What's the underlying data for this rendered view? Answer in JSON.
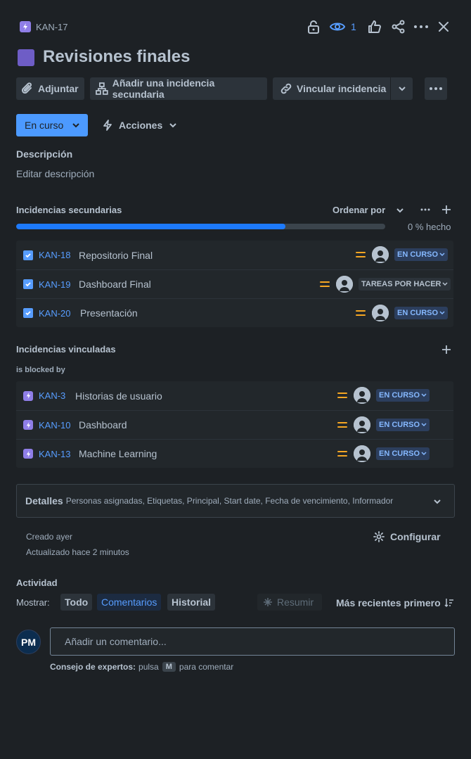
{
  "header": {
    "issue_key": "KAN-17",
    "watch_count": "1",
    "title": "Revisiones finales"
  },
  "toolbar": {
    "attach_label": "Adjuntar",
    "add_child_label": "Añadir una incidencia secundaria",
    "link_label": "Vincular incidencia"
  },
  "status": {
    "current": "En curso",
    "actions_label": "Acciones"
  },
  "description": {
    "heading": "Descripción",
    "placeholder": "Editar descripción"
  },
  "child_issues": {
    "heading": "Incidencias secundarias",
    "order_label": "Ordenar por",
    "progress_label": "0 % hecho",
    "progress_fraction": 0.73,
    "items": [
      {
        "key": "KAN-18",
        "summary": "Repositorio Final",
        "status": "EN CURSO"
      },
      {
        "key": "KAN-19",
        "summary": "Dashboard Final",
        "status": "TAREAS POR HACER"
      },
      {
        "key": "KAN-20",
        "summary": "Presentación",
        "status": "EN CURSO"
      }
    ]
  },
  "linked_issues": {
    "heading": "Incidencias vinculadas",
    "relation": "is blocked by",
    "items": [
      {
        "key": "KAN-3",
        "summary": "Historias de usuario",
        "status": "EN CURSO"
      },
      {
        "key": "KAN-10",
        "summary": "Dashboard",
        "status": "EN CURSO"
      },
      {
        "key": "KAN-13",
        "summary": "Machine Learning",
        "status": "EN CURSO"
      }
    ]
  },
  "details": {
    "heading": "Detalles",
    "fields_summary": "Personas asignadas, Etiquetas, Principal, Start date, Fecha de vencimiento, Informador"
  },
  "meta": {
    "created": "Creado ayer",
    "updated": "Actualizado hace 2 minutos",
    "configure_label": "Configurar"
  },
  "activity": {
    "heading": "Actividad",
    "show_label": "Mostrar:",
    "tabs": [
      "Todo",
      "Comentarios",
      "Historial"
    ],
    "summarize_label": "Resumir",
    "sort_label": "Más recientes primero",
    "avatar_initials": "PM",
    "comment_placeholder": "Añadir un comentario...",
    "tip_prefix": "Consejo de expertos:",
    "tip_middle": "pulsa",
    "tip_key": "M",
    "tip_suffix": "para comentar"
  },
  "colors": {
    "background": "#1d2125",
    "accent": "#579dff",
    "status_button": "#4c9aff",
    "priority": "#f5a623",
    "epic": "#8f7ee7"
  }
}
